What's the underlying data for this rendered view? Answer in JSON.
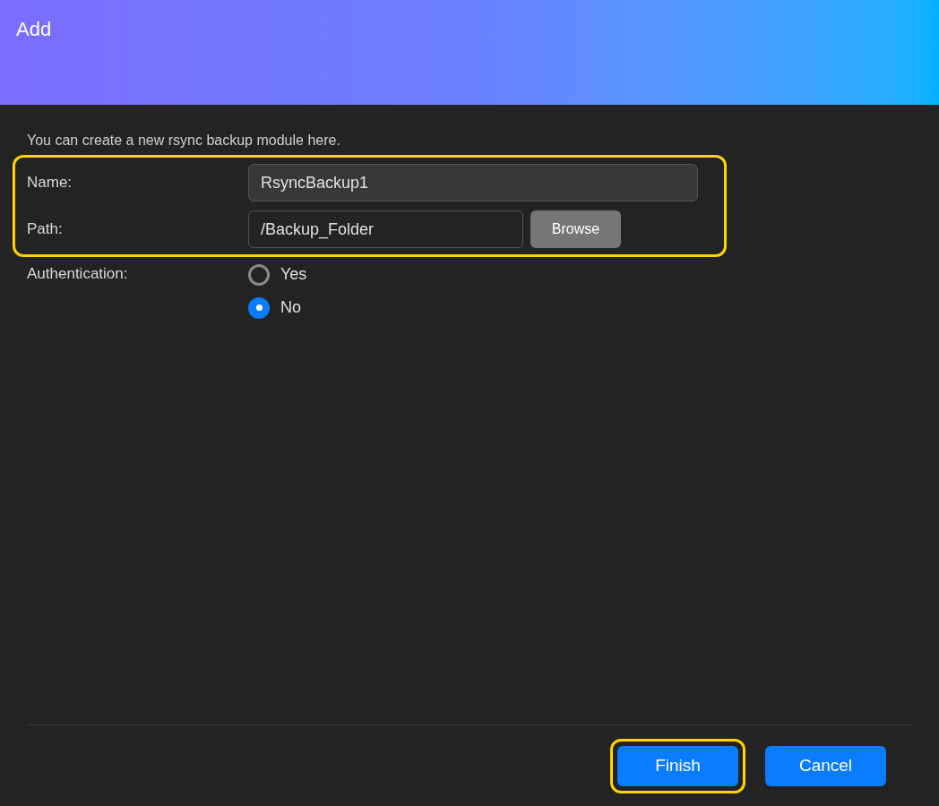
{
  "dialog": {
    "title": "Add"
  },
  "description": "You can create a new rsync backup module here.",
  "fields_group": {
    "highlighted": true,
    "fields": [
      {
        "kind": "text",
        "label": "Name:",
        "value": "RsyncBackup1"
      },
      {
        "kind": "browse",
        "label": "Path:",
        "value": "/Backup_Folder",
        "button": "Browse"
      }
    ]
  },
  "authentication": {
    "label": "Authentication:",
    "options": [
      {
        "label": "Yes",
        "selected": false
      },
      {
        "label": "No",
        "selected": true
      }
    ]
  },
  "buttons": [
    {
      "label": "Finish",
      "highlighted": true
    },
    {
      "label": "Cancel",
      "highlighted": false
    }
  ]
}
